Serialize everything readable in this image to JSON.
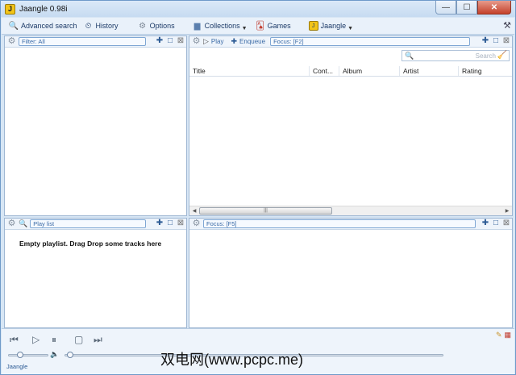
{
  "window": {
    "title": "Jaangle 0.98i",
    "icon_letter": "J"
  },
  "window_controls": {
    "minimize": "—",
    "maximize": "☐",
    "close": "✕"
  },
  "toolbar": {
    "items": [
      {
        "label": "Advanced search",
        "icon": "advanced-search-icon"
      },
      {
        "label": "History",
        "icon": "history-icon"
      },
      {
        "label": "Options",
        "icon": "gear-icon"
      },
      {
        "label": "Collections",
        "icon": "folder-icon"
      },
      {
        "label": "Games",
        "icon": "cards-icon"
      },
      {
        "label": "Jaangle",
        "icon": "jaangle-icon"
      }
    ]
  },
  "panes": {
    "filter": {
      "chip": "Filter: All"
    },
    "tracks": {
      "play_label": "Play",
      "enqueue_label": "Enqueue",
      "focus_chip": "Focus: [F2]",
      "search_placeholder": "Search",
      "columns": [
        "Title",
        "Cont...",
        "Album",
        "Artist",
        "Rating"
      ]
    },
    "playlist": {
      "chip": "Play list",
      "empty_message": "Empty playlist. Drag Drop some tracks here"
    },
    "info": {
      "focus_chip": "Focus: [F5]"
    }
  },
  "player": {
    "status": "Jaangle"
  },
  "watermark": {
    "text": "双电网(www.pcpc.me)"
  }
}
